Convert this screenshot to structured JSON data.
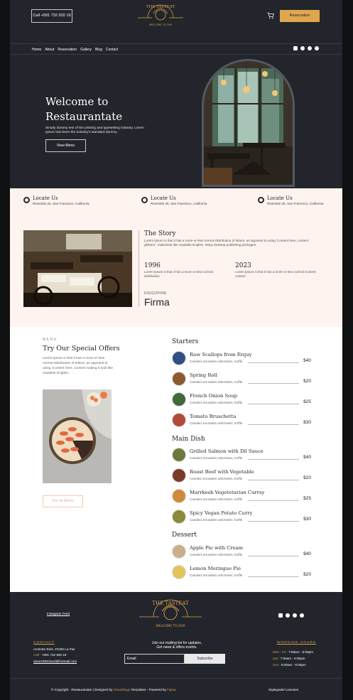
{
  "header": {
    "call_label": "Call +591 732 920 19",
    "logo_top": "THE TASTEAT",
    "logo_bottom": "WELCOME TO OUR",
    "reservation_label": "Reservation",
    "nav": [
      "Home",
      "About",
      "Reservation",
      "Gallery",
      "Blog",
      "Contact"
    ],
    "socials": [
      "instagram-icon",
      "facebook-icon",
      "twitter-icon",
      "pinterest-icon"
    ]
  },
  "hero": {
    "title_line1": "Welcome to",
    "title_line2": "Restaurantate",
    "subtitle": "Simply dummy text of the printing and typesetting industry. Lorem Ipsum has been the industry's standard dummy .",
    "button_label": "View Menu"
  },
  "locations": [
    {
      "title": "Locate Us",
      "address": "Riverside 25, San Francisco, California",
      "icon": "location-icon"
    },
    {
      "title": "Locate Us",
      "address": "Riverside 25, San Francisco, California",
      "icon": "clock-icon"
    },
    {
      "title": "Locate Us",
      "address": "Riverside 25, San Francisco, California",
      "icon": "phone-icon"
    }
  ],
  "story": {
    "title": "The Story",
    "text": "Lorem Ipsum is that it has a more-or-less normal distribution of letters, as opposed to using 'Content here, content gfshere', makinlook like readable English. Many desktop publishing packages.",
    "year1": "1996",
    "year1_text": "Lorem Ipsum is that it has a more-or-less normal distribution",
    "year2": "2023",
    "year2_text": "Lorem Ipsum is that it has a more-or-less normal Content content",
    "signature_label": "DIEGOFINE",
    "signature": "Firma"
  },
  "menu": {
    "label": "MENU",
    "title": "Try Our Special Offers",
    "description": "Lorem Ipsum is that it has a more-or-less normal distribution of letters, as opposed to using 'Content here, content making it look like readable English.",
    "see_all_label": "See all dishes",
    "categories": [
      {
        "name": "Starters",
        "dishes": [
          {
            "name": "Raw Scallops from Erquy",
            "desc": "Candied Jerusalem artichokes, truffle",
            "price": "$40",
            "color": "#2f4f86"
          },
          {
            "name": "Spring Roll",
            "desc": "Candied Jerusalem artichokes, truffle",
            "price": "$20",
            "color": "#8a5a2e"
          },
          {
            "name": "French Onion Soup",
            "desc": "Candied Jerusalem artichokes, truffle",
            "price": "$25",
            "color": "#3f6a3a"
          },
          {
            "name": "Tomato Bruschetta",
            "desc": "Candied Jerusalem artichokes, truffle",
            "price": "$30",
            "color": "#b24a3a"
          }
        ]
      },
      {
        "name": "Main Dish",
        "dishes": [
          {
            "name": "Grilled Salmon with Dil Sauce",
            "desc": "Candied Jerusalem artichokes, truffle",
            "price": "$40",
            "color": "#6b7a3a"
          },
          {
            "name": "Roast Beef with Vegetable",
            "desc": "Candied Jerusalem artichokes, truffle",
            "price": "$20",
            "color": "#7a3a2a"
          },
          {
            "name": "Marrkesh Vegetetarian Currsy",
            "desc": "Candied Jerusalem artichokes, truffle",
            "price": "$25",
            "color": "#d08a3a"
          },
          {
            "name": "Spicy Vegan Potato Curry",
            "desc": "Candied Jerusalem artichokes, truffle",
            "price": "$30",
            "color": "#8a8a3a"
          }
        ]
      },
      {
        "name": "Dessert",
        "dishes": [
          {
            "name": "Apple Pie with Cream",
            "desc": "Candied Jerusalem artichokes, truffle",
            "price": "$40",
            "color": "#c9b08a"
          },
          {
            "name": "Lemon Meringue Pie",
            "desc": "Candied Jerusalem artichokes, truffle",
            "price": "$20",
            "color": "#e3c45a"
          }
        ]
      }
    ]
  },
  "footer": {
    "instagram_label": "Instagram Feed",
    "contact_title": "CONTACT",
    "address": "Av.Entre Rios, #1020 La Paz",
    "phone_prefix": "Call :",
    "phone": "+591 732 920 19",
    "email": "omar1992cloud@hotmail.com",
    "mailing_line1": "Join our mailing list for updates,",
    "mailing_line2": "Get news & offers events.",
    "email_placeholder": "Email",
    "subscribe_label": "Subscribe",
    "hours_title": "WORKING HOURS",
    "hours": [
      {
        "day": "Mon - Fri :",
        "time": "7:00am - 6:00pm"
      },
      {
        "day": "Sat :",
        "time": "7:00am - 6:00pm"
      },
      {
        "day": "Sun :",
        "time": "8:00am - 6:00pm"
      }
    ],
    "copyright": "© Copyright - Restaurantate | Designed by",
    "designer": "OmarDiego",
    "templates": "Templates - Powered by",
    "powered": "Figma",
    "styleguide": "Styleguide/ Licenses"
  },
  "colors": {
    "dark": "#22252b",
    "accent": "#e0a64e",
    "cream": "#fdf3ef"
  }
}
